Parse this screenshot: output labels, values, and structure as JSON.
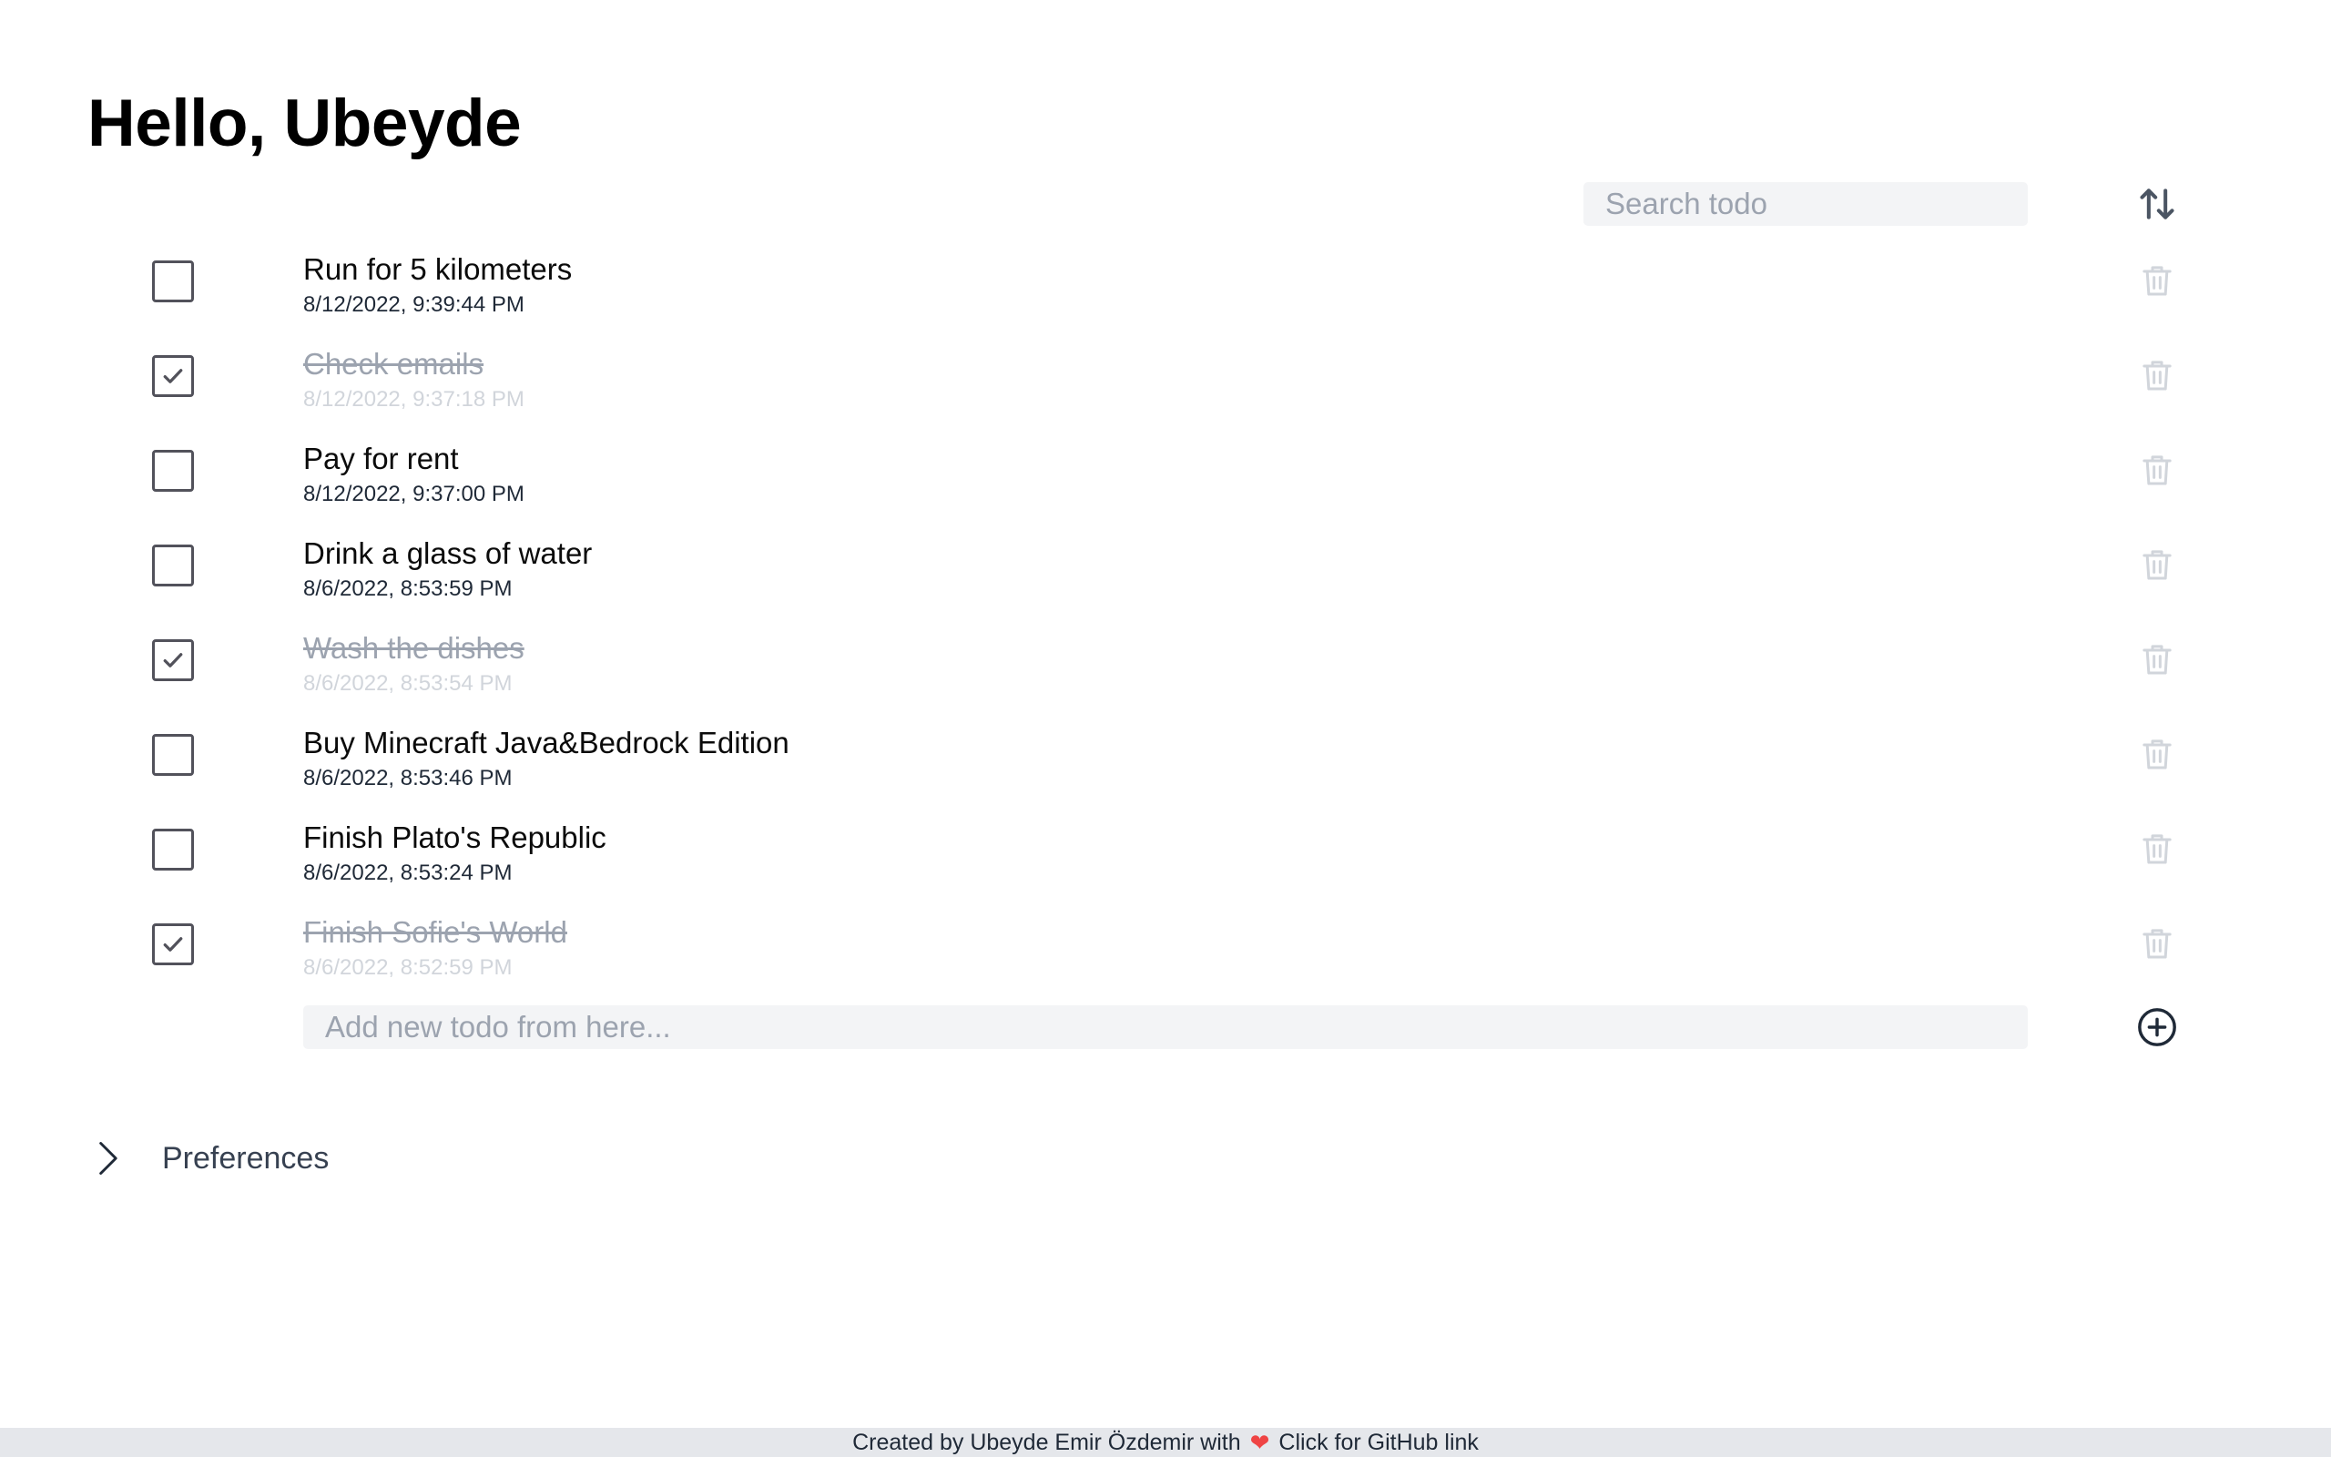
{
  "greeting": "Hello, Ubeyde",
  "search": {
    "placeholder": "Search todo"
  },
  "sort_icon": "sort-arrows-icon",
  "todos": [
    {
      "title": "Run for 5 kilometers",
      "date": "8/12/2022, 9:39:44 PM",
      "done": false
    },
    {
      "title": "Check emails",
      "date": "8/12/2022, 9:37:18 PM",
      "done": true
    },
    {
      "title": "Pay for rent",
      "date": "8/12/2022, 9:37:00 PM",
      "done": false
    },
    {
      "title": "Drink a glass of water",
      "date": "8/6/2022, 8:53:59 PM",
      "done": false
    },
    {
      "title": "Wash the dishes",
      "date": "8/6/2022, 8:53:54 PM",
      "done": true
    },
    {
      "title": "Buy Minecraft Java&Bedrock Edition",
      "date": "8/6/2022, 8:53:46 PM",
      "done": false
    },
    {
      "title": "Finish Plato's Republic",
      "date": "8/6/2022, 8:53:24 PM",
      "done": false
    },
    {
      "title": "Finish Sofie's World",
      "date": "8/6/2022, 8:52:59 PM",
      "done": true
    }
  ],
  "add_todo": {
    "placeholder": "Add new todo from here..."
  },
  "preferences": {
    "label": "Preferences"
  },
  "footer": {
    "created_by": "Created by Ubeyde Emir Özdemir with",
    "heart": "❤",
    "github": "Click for GitHub link"
  },
  "colors": {
    "checkbox_border": "#52525b",
    "done_text": "#9ca3af",
    "trash_icon": "#d1d5db",
    "input_bg": "#f3f4f6",
    "footer_bg": "#e5e7eb",
    "heart": "#ef4444"
  }
}
